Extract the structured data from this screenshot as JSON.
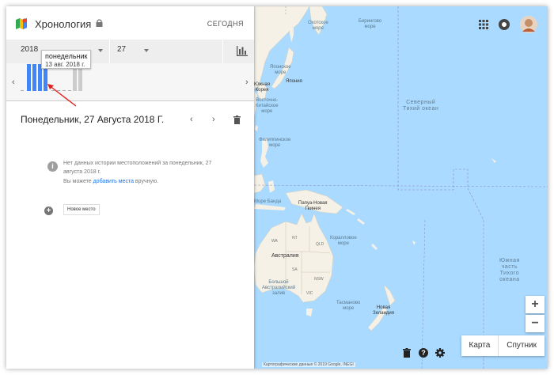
{
  "header": {
    "title": "Хронология",
    "today_label": "СЕГОДНЯ"
  },
  "date_selector": {
    "year": "2018",
    "day": "27"
  },
  "histogram": {
    "tooltip_day": "понедельник",
    "tooltip_date": "13 авг. 2018 г."
  },
  "day_view": {
    "title": "Понедельник, 27 Августа 2018 Г."
  },
  "no_data": {
    "message": "Нет данных истории местоположений за понедельник, 27 августа 2018 г.",
    "add_prefix": "Вы можете",
    "add_link": "добавить места",
    "add_suffix": "вручную."
  },
  "new_place_label": "Новое место",
  "map": {
    "labels": {
      "okhotsk": "Охотское\nморе",
      "bering": "Берингово\nморе",
      "japan_sea": "Японское\nморе",
      "japan": "Япония",
      "south_korea": "Южная\nКорея",
      "ecs": "Восточно-\nКитайское\nморе",
      "philippine": "Филиппинское\nморе",
      "north_pacific": "Северный\nТихий океан",
      "south_pacific": "Южная\nчасть\nТихого\nокеана",
      "banda": "Море Банда",
      "png": "Папуа-Новая\nГвинея",
      "coral": "Коралловое\nморе",
      "australia": "Австралия",
      "gab": "Большой\nАвстралийский\nзалив",
      "tasman": "Тасманово\nморе",
      "nz": "Новая\nЗеландия",
      "wa": "WA",
      "nt": "NT",
      "qld": "QLD",
      "sa": "SA",
      "nsw": "NSW",
      "vic": "VIC"
    },
    "map_type": [
      "Карта",
      "Спутник"
    ],
    "attribution": "Картографические данные © 2019 Google, INEGI"
  },
  "colors": {
    "ocean": "#aadaff",
    "land": "#f5f1e6",
    "bar_active": "#4285f4",
    "bar_inactive": "#cccccc",
    "link": "#1a73e8"
  },
  "icons": [
    "timeline-logo-icon",
    "lock-icon",
    "caret-down-icon",
    "bar-chart-icon",
    "chevron-left-icon",
    "chevron-right-icon",
    "trash-icon",
    "info-icon",
    "add-place-icon",
    "apps-icon",
    "notification-icon",
    "avatar",
    "help-icon",
    "settings-icon",
    "zoom-in-icon",
    "zoom-out-icon"
  ]
}
